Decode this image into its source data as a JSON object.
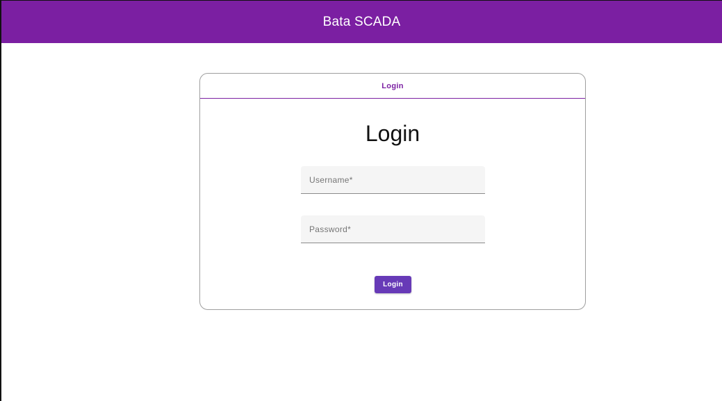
{
  "app_bar": {
    "title": "Bata SCADA",
    "color": "#7b1fa2"
  },
  "login_card": {
    "tab_label": "Login",
    "heading": "Login",
    "username": {
      "value": "",
      "placeholder": "Username*"
    },
    "password": {
      "value": "",
      "placeholder": "Password*"
    },
    "submit_label": "Login",
    "button_color": "#673ab7"
  }
}
